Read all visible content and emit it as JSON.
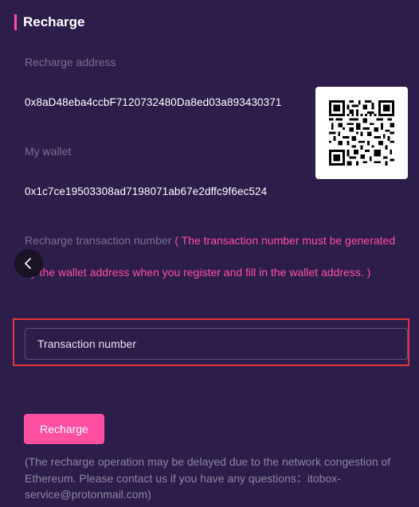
{
  "section": {
    "title": "Recharge"
  },
  "recharge_address": {
    "label": "Recharge address",
    "value": "0x8aD48eba4ccbF7120732480Da8ed03a893430371"
  },
  "my_wallet": {
    "label": "My wallet",
    "value": "0x1c7ce19503308ad7198071ab67e2dffc9f6ec524"
  },
  "transaction": {
    "label": "Recharge transaction number",
    "note": " ( The transaction number must be generated by the wallet address when you register and fill in the wallet address. )",
    "input_value": "",
    "placeholder": "Transaction number"
  },
  "actions": {
    "recharge_label": "Recharge"
  },
  "notice": "(The recharge operation may be delayed due to the network congestion of Ethereum. Please contact us if you have any questions：itobox-service@protonmail.com)",
  "icons": {
    "back": "chevron-left-icon",
    "qr": "qr-code-icon"
  },
  "colors": {
    "background": "#2c1d4a",
    "accent": "#ff4fa3",
    "highlight_border": "#e2343b",
    "muted_text": "#7a6f90"
  }
}
